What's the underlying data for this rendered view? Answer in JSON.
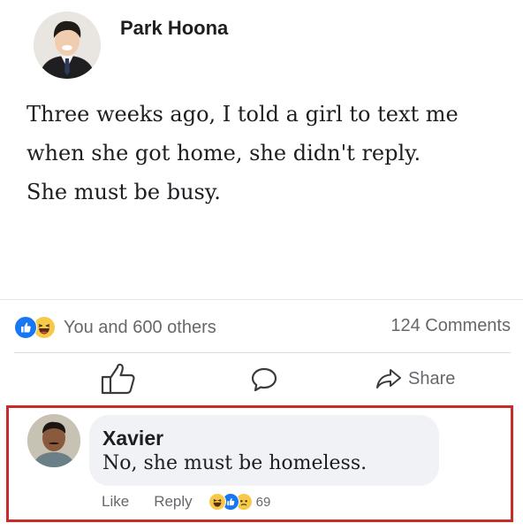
{
  "post": {
    "author": "Park Hoona",
    "lines": [
      "Three weeks ago, I told a girl to text me",
      "when she got home, she didn't reply.",
      "She must be busy."
    ]
  },
  "stats": {
    "reactions_text": "You and 600 others",
    "comments_text": "124 Comments",
    "reaction_icons": [
      "like-icon",
      "haha-icon"
    ]
  },
  "actions": {
    "like_icon": "thumbs-up-icon",
    "comment_icon": "comment-bubble-icon",
    "share_label": "Share"
  },
  "comment": {
    "name": "Xavier",
    "text": "No, she must be homeless.",
    "like_label": "Like",
    "reply_label": "Reply",
    "reaction_count": "69",
    "reaction_icons": [
      "haha-icon",
      "like-icon",
      "sad-icon"
    ]
  },
  "colors": {
    "facebook_blue": "#1877f2",
    "highlight_red": "#c92a2a",
    "muted_text": "#65676b"
  }
}
